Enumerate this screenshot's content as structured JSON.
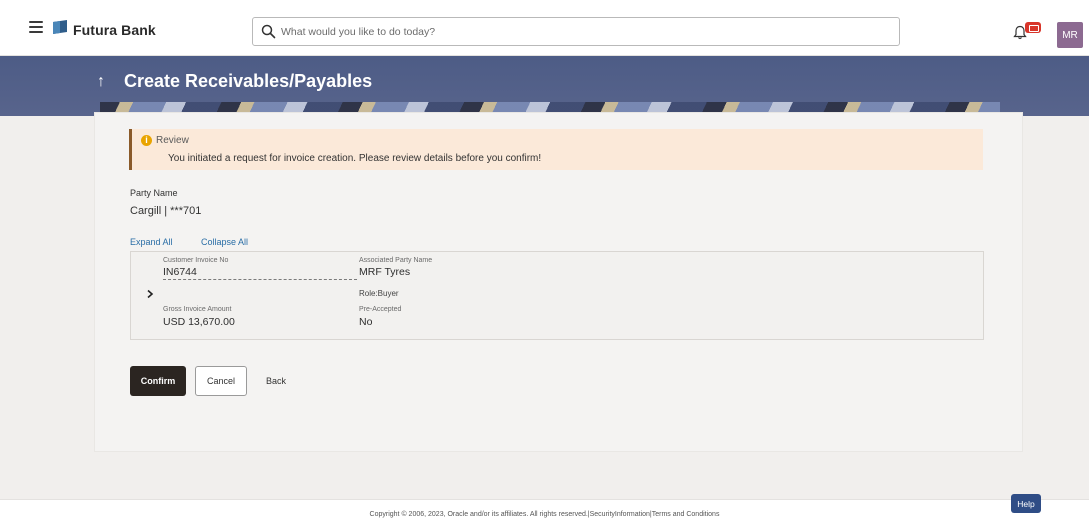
{
  "header": {
    "brand": "Futura Bank",
    "search_placeholder": "What would you like to do today?",
    "avatar_initials": "MR"
  },
  "banner": {
    "title": "Create Receivables/Payables"
  },
  "review": {
    "title": "Review",
    "message": "You initiated a request for invoice creation. Please review details before you confirm!"
  },
  "party": {
    "label": "Party Name",
    "value": "Cargill | ***701"
  },
  "links": {
    "expand_all": "Expand All",
    "collapse_all": "Collapse All"
  },
  "invoice": {
    "customer_invoice_no_label": "Customer Invoice No",
    "customer_invoice_no": "IN6744",
    "associated_party_label": "Associated Party Name",
    "associated_party": "MRF Tyres",
    "role": "Role:Buyer",
    "gross_amount_label": "Gross Invoice Amount",
    "gross_amount": "USD 13,670.00",
    "pre_accepted_label": "Pre-Accepted",
    "pre_accepted": "No"
  },
  "actions": {
    "confirm": "Confirm",
    "cancel": "Cancel",
    "back": "Back"
  },
  "footer": {
    "copyright": "Copyright © 2006, 2023, Oracle and/or its affiliates. All rights reserved.|SecurityInformation|Terms and Conditions",
    "help": "Help"
  },
  "colors": {
    "banner": "#4d5c86",
    "primary_button": "#2b2521",
    "link": "#2a6ea6",
    "review_background": "#fbe9d9",
    "avatar": "#8c6a91",
    "notification_badge": "#d8352a",
    "help_button": "#2f4d86"
  },
  "icons": [
    "hamburger-menu-icon",
    "bank-logo-icon",
    "search-icon",
    "bell-icon",
    "notification-badge-icon",
    "back-arrow-icon",
    "info-icon",
    "chevron-right-icon"
  ]
}
